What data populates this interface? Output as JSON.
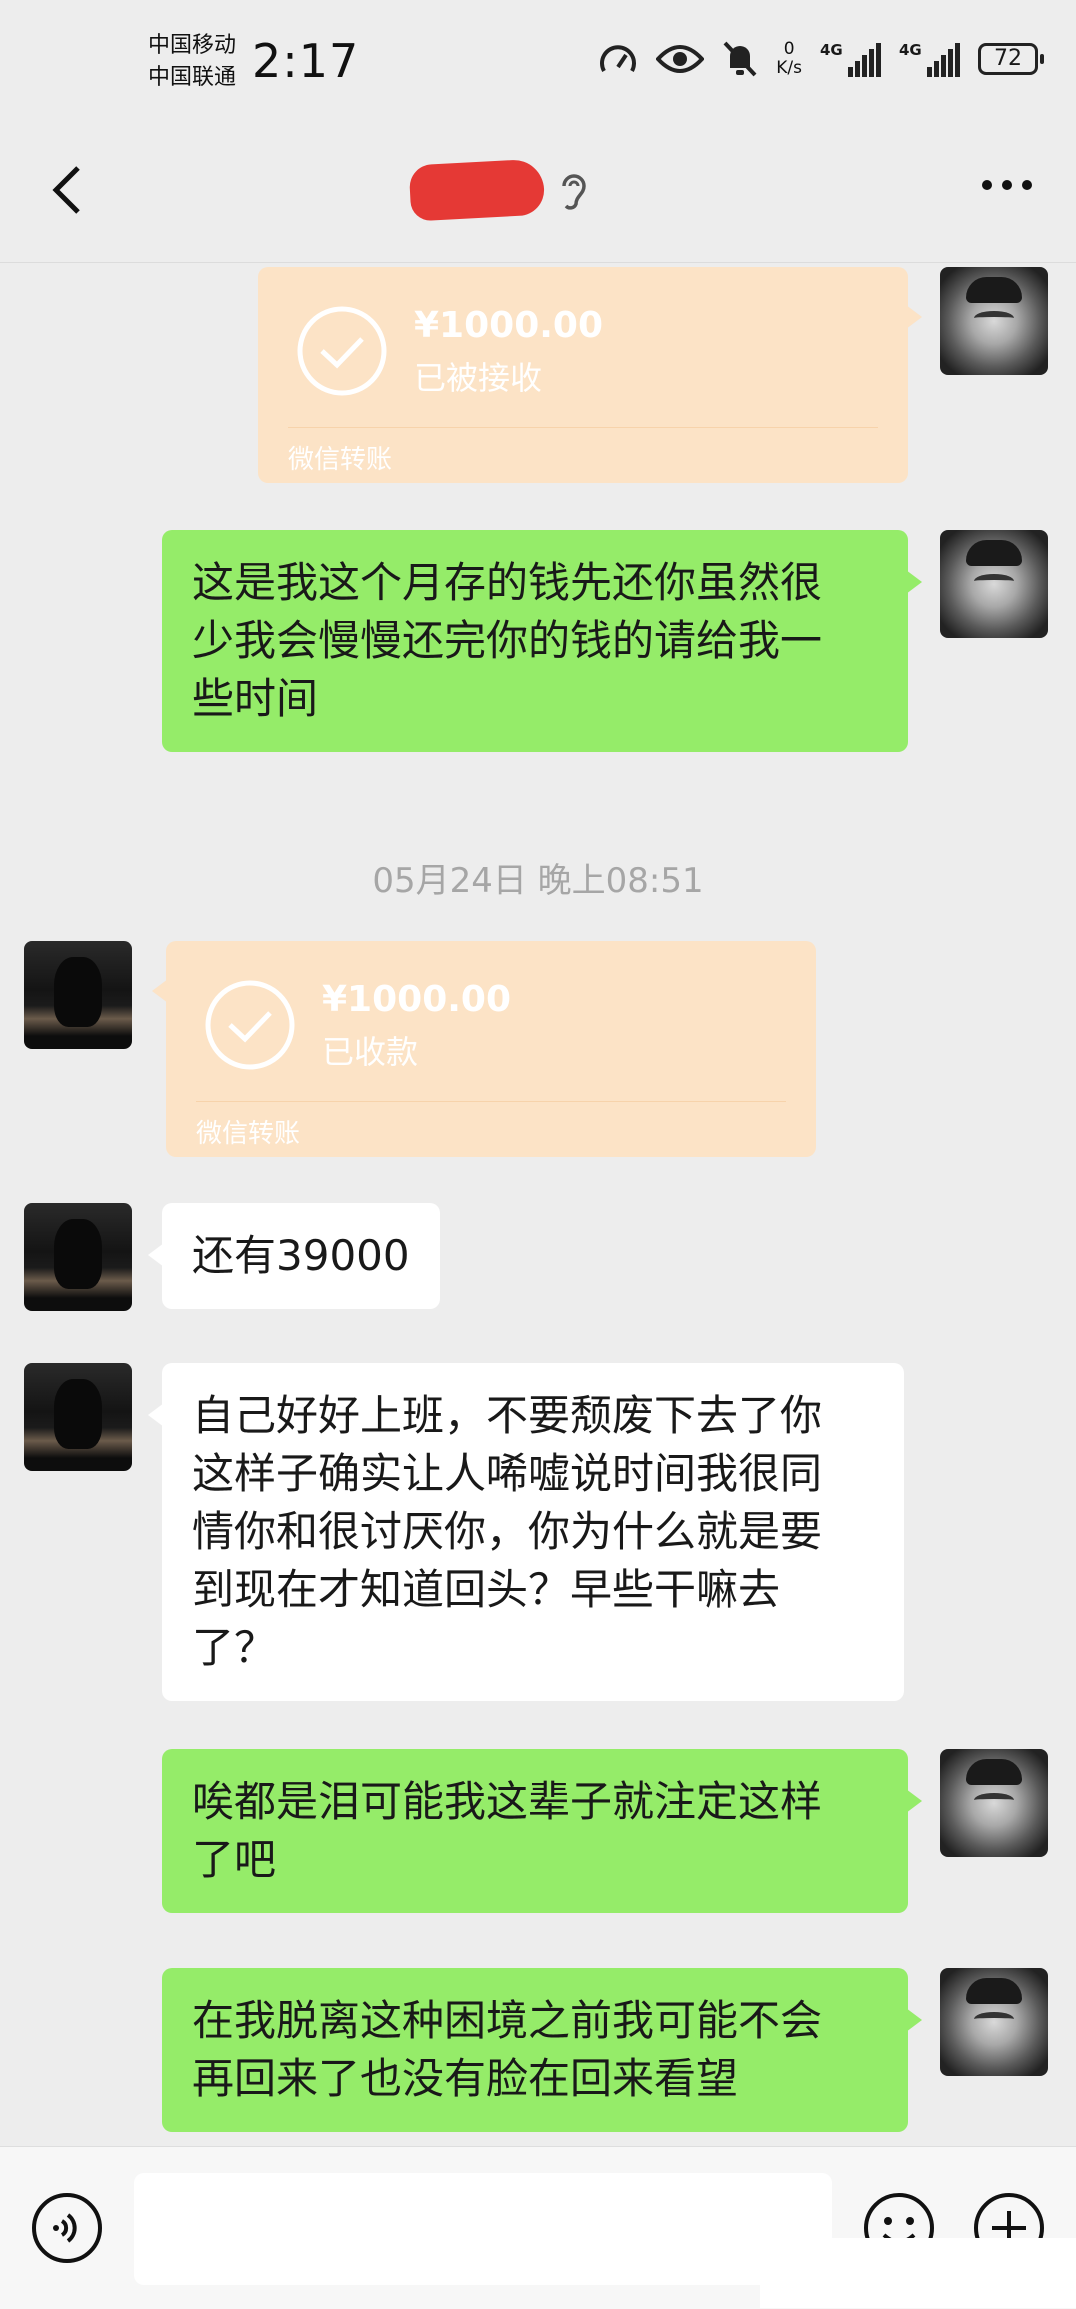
{
  "status_bar": {
    "carrier_1": "中国移动",
    "carrier_2": "中国联通",
    "time": "2:17",
    "net_speed_value": "0",
    "net_speed_unit": "K/s",
    "signal_1_label": "4G",
    "signal_2_label": "4G",
    "battery": "72"
  },
  "nav": {
    "contact_name_redacted": true,
    "icons": [
      "back-icon",
      "ear-icon",
      "more-icon"
    ]
  },
  "messages": [
    {
      "side": "me",
      "type": "transfer",
      "amount": "¥1000.00",
      "status": "已被接收",
      "footer": "微信转账"
    },
    {
      "side": "me",
      "type": "text",
      "lines": [
        "这是我这个月存的钱先还你虽然很",
        "少我会慢慢还完你的钱的请给我一",
        "些时间"
      ]
    },
    {
      "type": "timestamp",
      "text": "05月24日 晚上08:51"
    },
    {
      "side": "peer",
      "type": "transfer",
      "amount": "¥1000.00",
      "status": "已收款",
      "footer": "微信转账"
    },
    {
      "side": "peer",
      "type": "text",
      "lines": [
        "还有39000"
      ]
    },
    {
      "side": "peer",
      "type": "text",
      "lines": [
        "自己好好上班，不要颓废下去了你",
        "这样子确实让人唏嘘说时间我很同",
        "情你和很讨厌你，你为什么就是要",
        "到现在才知道回头？早些干嘛去",
        "了？"
      ]
    },
    {
      "side": "me",
      "type": "text",
      "lines": [
        "唉都是泪可能我这辈子就注定这样",
        "了吧"
      ]
    },
    {
      "side": "me",
      "type": "text",
      "lines": [
        "在我脱离这种困境之前我可能不会",
        "再回来了也没有脸在回来看望"
      ]
    }
  ],
  "input_bar": {
    "value": "",
    "icons": [
      "voice-icon",
      "emoji-icon",
      "plus-icon"
    ]
  },
  "colors": {
    "background": "#ededed",
    "sent_bubble": "#95ec69",
    "received_bubble": "#ffffff",
    "transfer_card": "#fce3c6",
    "redaction": "#e53935"
  }
}
